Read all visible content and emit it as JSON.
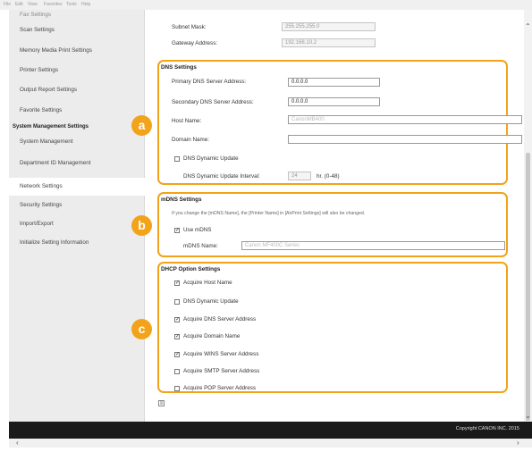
{
  "menubar": [
    "File",
    "Edit",
    "View",
    "Favorites",
    "Tools",
    "Help"
  ],
  "sidebar": {
    "items": [
      "Fax Settings",
      "Scan Settings",
      "Memory Media Print Settings",
      "Printer Settings",
      "Output Report Settings",
      "Favorite Settings",
      "System Management Settings",
      "System Management",
      "Department ID Management",
      "Network Settings",
      "Security Settings",
      "Import/Export",
      "Initialize Setting Information"
    ]
  },
  "top": {
    "subnet_label": "Subnet Mask:",
    "subnet_value": "255.255.255.0",
    "gateway_label": "Gateway Address:",
    "gateway_value": "192.168.10.2"
  },
  "dns": {
    "title": "DNS Settings",
    "primary_label": "Primary DNS Server Address:",
    "primary_value": "0.0.0.0",
    "secondary_label": "Secondary DNS Server Address:",
    "secondary_value": "0.0.0.0",
    "host_label": "Host Name:",
    "host_value": "CanonMB400",
    "domain_label": "Domain Name:",
    "domain_value": "",
    "dynamic_update_label": "DNS Dynamic Update",
    "dynamic_update_checked": false,
    "interval_label": "DNS Dynamic Update Interval:",
    "interval_value": "24",
    "interval_unit": "hr. (0-48)"
  },
  "mdns": {
    "title": "mDNS Settings",
    "note": "If you change the [mDNS Name], the [Printer Name] in [AirPrint Settings] will also be changed.",
    "use_label": "Use mDNS",
    "use_checked": true,
    "name_label": "mDNS Name:",
    "name_value": "Canon MF400C Series"
  },
  "dhcp": {
    "title": "DHCP Option Settings",
    "options": [
      {
        "label": "Acquire Host Name",
        "checked": true
      },
      {
        "label": "DNS Dynamic Update",
        "checked": false
      },
      {
        "label": "Acquire DNS Server Address",
        "checked": true
      },
      {
        "label": "Acquire Domain Name",
        "checked": true
      },
      {
        "label": "Acquire WINS Server Address",
        "checked": true
      },
      {
        "label": "Acquire SMTP Server Address",
        "checked": false
      },
      {
        "label": "Acquire POP Server Address",
        "checked": false
      }
    ]
  },
  "badges": [
    "a",
    "b",
    "c"
  ],
  "footer": {
    "copyright": "Copyright CANON INC. 2015"
  },
  "colors": {
    "accent": "#f2a31a",
    "footer_bg": "#1a1a1a",
    "sidebar_bg": "#ececec"
  },
  "icons": [
    "scroll-up-arrow-icon",
    "scroll-down-arrow-icon",
    "scroll-left-arrow-icon",
    "scroll-right-arrow-icon",
    "page-top-icon"
  ]
}
